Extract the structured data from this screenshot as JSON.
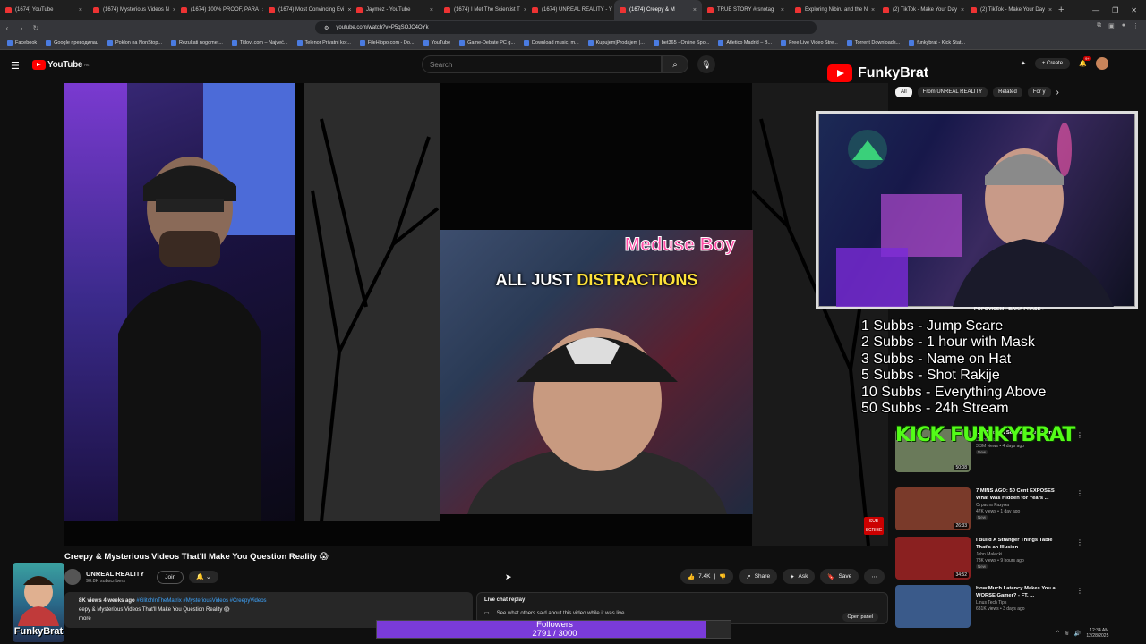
{
  "browser": {
    "tabs": [
      {
        "label": "(1674) YouTube",
        "active": false
      },
      {
        "label": "(1674) Mysterious Videos N",
        "active": false
      },
      {
        "label": "(1674) 100% PROOF, PARA",
        "active": false
      },
      {
        "label": "(1674) Most Convincing Evi",
        "active": false
      },
      {
        "label": "Jaymez - YouTube",
        "active": false
      },
      {
        "label": "(1674) I Met The Scientist T",
        "active": false
      },
      {
        "label": "(1674) UNREAL REALITY - Y",
        "active": false
      },
      {
        "label": "(1674) Creepy & M",
        "active": true
      },
      {
        "label": "TRUE STORY #rsnotag",
        "active": false
      },
      {
        "label": "Exploring Nibiru and the N",
        "active": false
      },
      {
        "label": "(2) TikTok - Make Your Day",
        "active": false
      },
      {
        "label": "(2) TikTok - Make Your Day",
        "active": false
      }
    ],
    "new_tab": "+",
    "url": "youtube.com/watch?v=P5qSOJC4OYk",
    "bookmarks": [
      "Facebook",
      "Google преводилац",
      "Poklon na NonStop...",
      "Rezultati nogomet...",
      "Titlovi.com – Najveć...",
      "Telenor Privatni kor...",
      "FileHippo.com - Do...",
      "YouTube",
      "Game-Debate PC g...",
      "Download music, m...",
      "Kupujem|Prodajem |...",
      "bet365 - Online Spo...",
      "Atletico Madrid – B...",
      "Free Live Video Stre...",
      "Torrent Downloads...",
      "funkybrat - Kick Stat..."
    ]
  },
  "youtube": {
    "logo_text": "YouTube",
    "logo_region": "RS",
    "search_placeholder": "Search",
    "create_label": "Create",
    "notif_count": "9+",
    "video_title": "Creepy & Mysterious Videos That'll Make You Question Reality 😱",
    "channel_name": "UNREAL REALITY",
    "channel_subs": "90.8K subscribers",
    "join_label": "Join",
    "likes": "7.4K",
    "share_label": "Share",
    "ask_label": "Ask",
    "save_label": "Save",
    "desc_stats": "8K views  4 weeks ago",
    "desc_tags": "#GlitchInTheMatrix #MysteriousVideos #CreepyVideos",
    "desc_line2": "eepy & Mysterious Videos That'll Make You Question Reality 😱",
    "desc_more": "more",
    "live_chat_title": "Live chat replay",
    "live_chat_sub": "See what others said about this video while it was live.",
    "open_panel": "Open panel",
    "chips": [
      {
        "label": "All",
        "selected": true
      },
      {
        "label": "From UNREAL REALITY",
        "selected": false
      },
      {
        "label": "Related",
        "selected": false
      },
      {
        "label": "For y",
        "selected": false
      }
    ]
  },
  "overlay": {
    "caption_top": "Meduse Boy",
    "caption_main_a": "ALL JUST ",
    "caption_main_b": "DISTRACTIONS",
    "sub_badge": "SUB SCRIBE",
    "funky_banner": "FunkyBrat",
    "rec_overlay_title": "POPOVICEM - BAKA PRASE -",
    "sub_goals": [
      "1 Subbs - Jump Scare",
      "2 Subbs - 1 hour with Mask",
      "3 Subbs - Name on Hat",
      "5 Subbs - Shot Rakije",
      "10 Subbs - Everything Above",
      "50 Subbs - 24h Stream"
    ],
    "kick_logo": "KICK FUNKYBRAT",
    "corner_logo_text": "FunkyBrat",
    "followers_label": "Followers",
    "followers_count": "2791 / 3000",
    "followers_fraction": 0.9303
  },
  "recommendations": [
    {
      "title": "...'s Body In Soldier's Bedroom",
      "channel": "Dr Insanity",
      "meta": "3.3M views • 4 days ago",
      "badge": "New",
      "duration": "50:08",
      "color": "#6a7a5a"
    },
    {
      "title": "7 MINS AGO: 50 Cent EXPOSES What Was Hidden for Years ...",
      "channel": "Страсть Разума",
      "meta": "47K views • 1 day ago",
      "badge": "New",
      "duration": "26:33",
      "color": "#7a3a2a"
    },
    {
      "title": "I Build A Stranger Things Table That's an Illusion",
      "channel": "John Malecki",
      "meta": "78K views • 9 hours ago",
      "badge": "New",
      "duration": "34:52",
      "color": "#8a2020"
    },
    {
      "title": "How Much Latency Makes You a WORSE Gamer? - FT. ...",
      "channel": "Linus Tech Tips",
      "meta": "631K views • 3 days ago",
      "badge": "",
      "duration": "",
      "color": "#3a5a8a"
    }
  ],
  "system": {
    "time": "12:34 AM",
    "date": "12/28/2025"
  }
}
